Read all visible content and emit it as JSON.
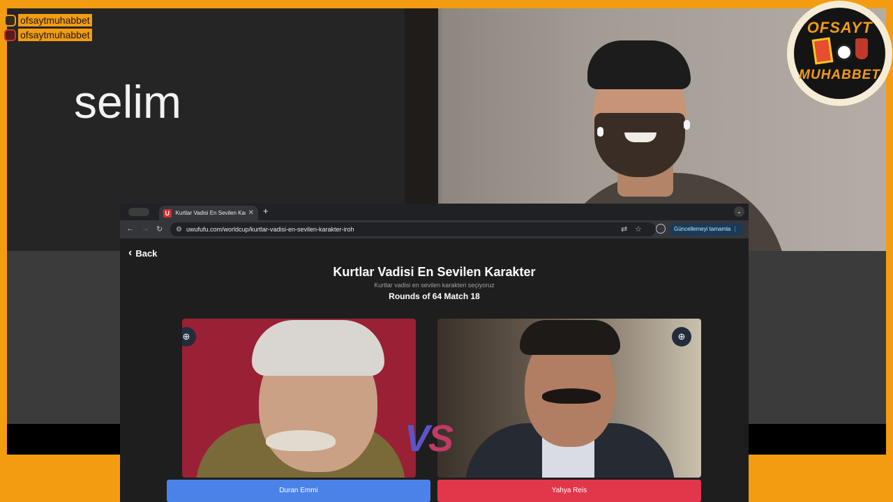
{
  "stream": {
    "speaker_name": "selim",
    "social_handles": [
      {
        "icon": "instagram-icon",
        "handle": "ofsaytmuhabbet"
      },
      {
        "icon": "youtube-icon",
        "handle": "ofsaytmuhabbet"
      }
    ],
    "logo": {
      "top_text": "OFSAYT",
      "bottom_text": "MUHABBET"
    },
    "colors": {
      "frame": "#f39c12",
      "panel": "#252526"
    }
  },
  "browser": {
    "tab": {
      "favicon": "U",
      "title": "Kurtlar Vadisi En Sevilen Karakter"
    },
    "new_tab_icon": "+",
    "url": "uwufufu.com/worldcup/kurtlar-vadisi-en-sevilen-karakter-iroh",
    "update_label": "Güncellemeyi tamamla"
  },
  "page": {
    "back_label": "Back",
    "title": "Kurtlar Vadisi En Sevilen Karakter",
    "subtitle": "Kurtlar vadisi en sevilen karakteri seçiyoruz",
    "round_info": "Rounds of 64 Match 18",
    "vs": {
      "v": "V",
      "s": "S"
    },
    "left_choice": "Duran Emmi",
    "right_choice": "Yahya Reis",
    "colors": {
      "left": "#4b82e8",
      "right": "#e2374a"
    }
  }
}
